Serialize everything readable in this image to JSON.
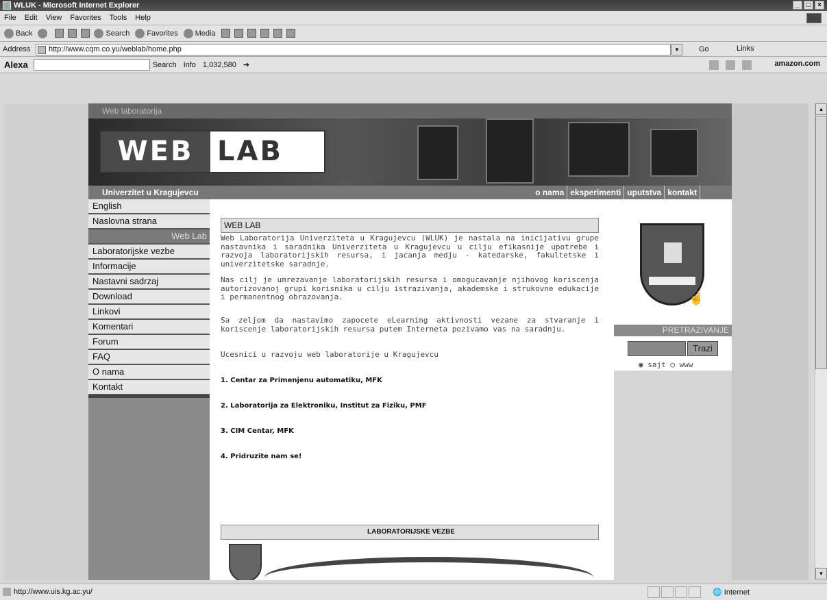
{
  "window": {
    "title": "WLUK - Microsoft Internet Explorer"
  },
  "menu": [
    "File",
    "Edit",
    "View",
    "Favorites",
    "Tools",
    "Help"
  ],
  "toolbar": {
    "back": "Back",
    "search": "Search",
    "favorites": "Favorites",
    "media": "Media"
  },
  "address": {
    "label": "Address",
    "url": "http://www.cqm.co.yu/weblab/home.php",
    "go": "Go",
    "links": "Links"
  },
  "alexa": {
    "logo": "Alexa",
    "search": "Search",
    "info": "Info",
    "rank": "1,032,580",
    "amazon": "amazon.com"
  },
  "site": {
    "header": "Web laboratorija",
    "logo_web": "WEB",
    "logo_lab": "LAB",
    "university": "Univerzitet u Kragujevcu",
    "topnav": [
      "o nama",
      "eksperimenti",
      "uputstva",
      "kontakt"
    ]
  },
  "leftnav": [
    {
      "label": "English"
    },
    {
      "label": "Naslovna strana"
    },
    {
      "label": "Web Lab",
      "section": true
    },
    {
      "label": "Laboratorijske vezbe"
    },
    {
      "label": "Informacije"
    },
    {
      "label": "Nastavni sadrzaj"
    },
    {
      "label": "Download"
    },
    {
      "label": "Linkovi"
    },
    {
      "label": "Komentari"
    },
    {
      "label": "Forum"
    },
    {
      "label": "FAQ"
    },
    {
      "label": "O nama"
    },
    {
      "label": "Kontakt"
    }
  ],
  "main": {
    "box_title": "WEB LAB",
    "p1": "Web Laboratorija Univerziteta u Kragujevcu (WLUK) je nastala na inicijativu grupe nastavnika i saradnika Univerziteta u Kragujevcu u cilju efikasnije upotrebe i razvoja laboratorijskih resursa, i jacanja medju - katedarske, fakultetske i univerzitetske saradnje.",
    "p2": "Nas cilj je umrezavanje laboratorijskih resursa i omogucavanje njihovog koriscenja autorizovanoj grupi korisnika u cilju istrazivanja, akademske i strukovne edukacije i permanentnog obrazovanja.",
    "p3": "Sa zeljom da nastavimo zapocete eLearning aktivnosti vezane za stvaranje i koriscenje laboratorijskih resursa putem Interneta pozivamo vas na saradnju.",
    "p4": "Ucesnici u razvoju web laboratorije u Kragujevcu",
    "items": [
      "1. Centar za Primenjenu automatiku, MFK",
      "2. Laboratorija za Elektroniku, Institut za Fiziku, PMF",
      "3. CIM Centar, MFK",
      "4. Pridruzite nam se!"
    ],
    "lab_title": "LABORATORIJSKE VEZBE"
  },
  "right": {
    "search_head": "PRETRAZIVANJE",
    "search_btn": "Trazi",
    "opt1": "sajt",
    "opt2": "www"
  },
  "status": {
    "text": "http://www.uis.kg.ac.yu/",
    "zone": "Internet"
  }
}
